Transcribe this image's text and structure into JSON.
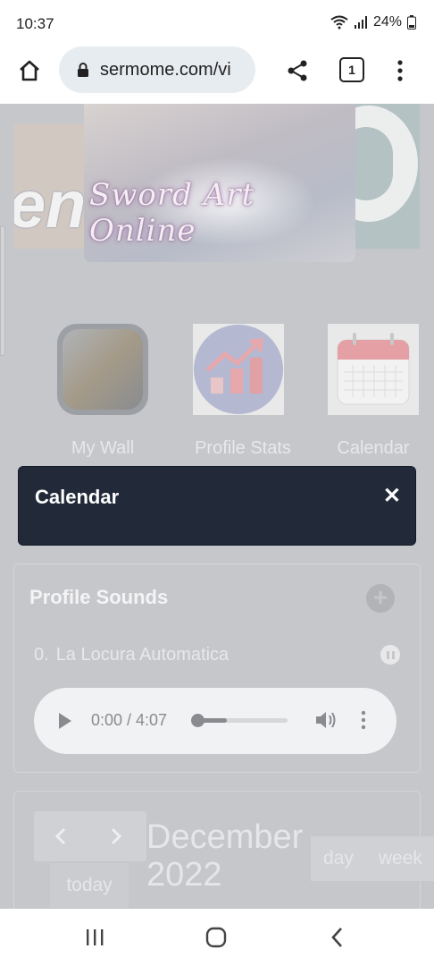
{
  "status_bar": {
    "time": "10:37",
    "battery": "24%"
  },
  "browser": {
    "url": "sermome.com/vi",
    "tab_count": "1"
  },
  "banner": {
    "left_text": "en",
    "main_title": "Sword Art Online"
  },
  "apps": [
    {
      "label": "My Wall"
    },
    {
      "label": "Profile Stats"
    },
    {
      "label": "Calendar"
    }
  ],
  "calendar_modal": {
    "title": "Calendar",
    "close": "✕"
  },
  "profile_sounds": {
    "heading": "Profile Sounds",
    "track_number": "0.",
    "track_title": "La Locura Automatica",
    "player_time": "0:00 / 4:07",
    "buffered_fraction": 0.35
  },
  "calendar_view": {
    "today_label": "today",
    "month_title": "December 2022",
    "view_day": "day",
    "view_week": "week"
  }
}
